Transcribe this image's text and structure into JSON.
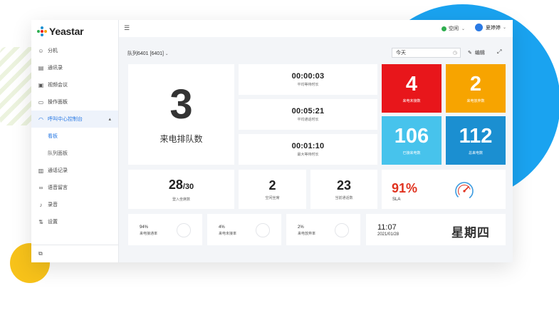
{
  "app": {
    "brand": "Yeastar"
  },
  "sidebar": {
    "items": [
      {
        "label": "分机",
        "icon": "extension-icon"
      },
      {
        "label": "通讯录",
        "icon": "contacts-icon"
      },
      {
        "label": "视频会议",
        "icon": "video-conference-icon"
      },
      {
        "label": "操作面板",
        "icon": "operator-panel-icon"
      },
      {
        "label": "呼叫中心控制台",
        "icon": "headset-icon"
      },
      {
        "label": "通话记录",
        "icon": "call-log-icon"
      },
      {
        "label": "语音留言",
        "icon": "voicemail-icon"
      },
      {
        "label": "录音",
        "icon": "microphone-icon"
      },
      {
        "label": "设置",
        "icon": "settings-icon"
      }
    ],
    "sub_items": [
      {
        "label": "看板"
      },
      {
        "label": "队列面板"
      }
    ]
  },
  "topbar": {
    "status_label": "空闲",
    "status_color": "#2eae4f",
    "user_name": "夏婷婷"
  },
  "header": {
    "queue_title": "队列6401 [6401]",
    "date_value": "今天",
    "edit_label": "编辑"
  },
  "dashboard": {
    "waiting_calls": {
      "value": "3",
      "label": "来电排队数"
    },
    "avg_wait": {
      "value": "00:00:03",
      "label": "平均等待时长"
    },
    "avg_talk": {
      "value": "00:05:21",
      "label": "平均通话时长"
    },
    "max_wait": {
      "value": "00:01:10",
      "label": "最大等待时长"
    },
    "tiles": [
      {
        "value": "4",
        "label": "来电未接数",
        "color": "#e8161b"
      },
      {
        "value": "2",
        "label": "来电放弃数",
        "color": "#f7a400"
      },
      {
        "value": "106",
        "label": "已接来电数",
        "color": "#47c3ec"
      },
      {
        "value": "112",
        "label": "总来电数",
        "color": "#1b8fd1"
      }
    ],
    "agents_logged": {
      "value": "28",
      "total": "/30",
      "label": "登入坐席数"
    },
    "agents_idle": {
      "value": "2",
      "label": "空闲坐席"
    },
    "calls_now": {
      "value": "23",
      "label": "当前通话数"
    },
    "sla": {
      "value": "91%",
      "label": "SLA",
      "color": "#e0321f"
    },
    "rates": [
      {
        "value": "94%",
        "label": "来电接通率"
      },
      {
        "value": "4%",
        "label": "来电未接率"
      },
      {
        "value": "2%",
        "label": "来电放弃率"
      }
    ],
    "clock": {
      "time": "11:07",
      "date": "2021/01/28",
      "weekday": "星期四"
    }
  }
}
